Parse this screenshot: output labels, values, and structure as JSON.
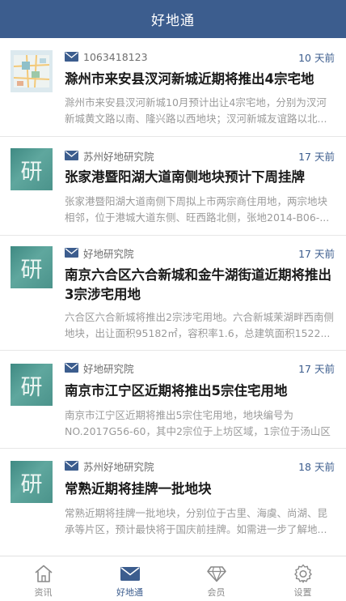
{
  "header": {
    "title": "好地通"
  },
  "colors": {
    "brand": "#3c5d8e",
    "time_text": "#3c5d8e",
    "summary_text": "#9a9a9a",
    "source_text": "#6f6f6f"
  },
  "feed": {
    "items": [
      {
        "thumb": {
          "type": "map-image"
        },
        "source_icon": "mail-icon",
        "source": "1063418123",
        "time": "10 天前",
        "title": "滁州市来安县汊河新城近期将推出4宗宅地",
        "summary": "滁州市来安县汊河新城10月预计出让4宗宅地，分别为汊河新城黄文路以南、隆兴路以西地块；汊河新城友谊路以北..."
      },
      {
        "thumb": {
          "type": "research-badge",
          "char": "研"
        },
        "source_icon": "mail-icon",
        "source": "苏州好地研究院",
        "time": "17 天前",
        "title": "张家港暨阳湖大道南侧地块预计下周挂牌",
        "summary": "张家港暨阳湖大道南侧下周拟上市两宗商住用地，两宗地块相邻，位于港城大道东侧、旺西路北侧，张地2014-B06-..."
      },
      {
        "thumb": {
          "type": "research-badge",
          "char": "研"
        },
        "source_icon": "mail-icon",
        "source": "好地研究院",
        "time": "17 天前",
        "title": "南京六合区六合新城和金牛湖街道近期将推出3宗涉宅用地",
        "summary": "六合区六合新城将推出2宗涉宅用地。六合新城茉湖畔西南侧地块，出让面积95182㎡，容积率1.6，总建筑面积1522..."
      },
      {
        "thumb": {
          "type": "research-badge",
          "char": "研"
        },
        "source_icon": "mail-icon",
        "source": "好地研究院",
        "time": "17 天前",
        "title": "南京市江宁区近期将推出5宗住宅用地",
        "summary": "南京市江宁区近期将推出5宗住宅用地，地块编号为NO.2017G56-60，其中2宗位于上坊区域，1宗位于汤山区域..."
      },
      {
        "thumb": {
          "type": "research-badge",
          "char": "研"
        },
        "source_icon": "mail-icon",
        "source": "苏州好地研究院",
        "time": "18 天前",
        "title": "常熟近期将挂牌一批地块",
        "summary": "常熟近期将挂牌一批地块，分别位于古里、海虞、尚湖、昆承等片区，预计最快将于国庆前挂牌。如需进一步了解地..."
      }
    ]
  },
  "tabbar": {
    "tabs": [
      {
        "label": "资讯",
        "icon": "home-icon",
        "active": false
      },
      {
        "label": "好地通",
        "icon": "mail-icon",
        "active": true
      },
      {
        "label": "会员",
        "icon": "diamond-icon",
        "active": false
      },
      {
        "label": "设置",
        "icon": "gear-icon",
        "active": false
      }
    ]
  }
}
